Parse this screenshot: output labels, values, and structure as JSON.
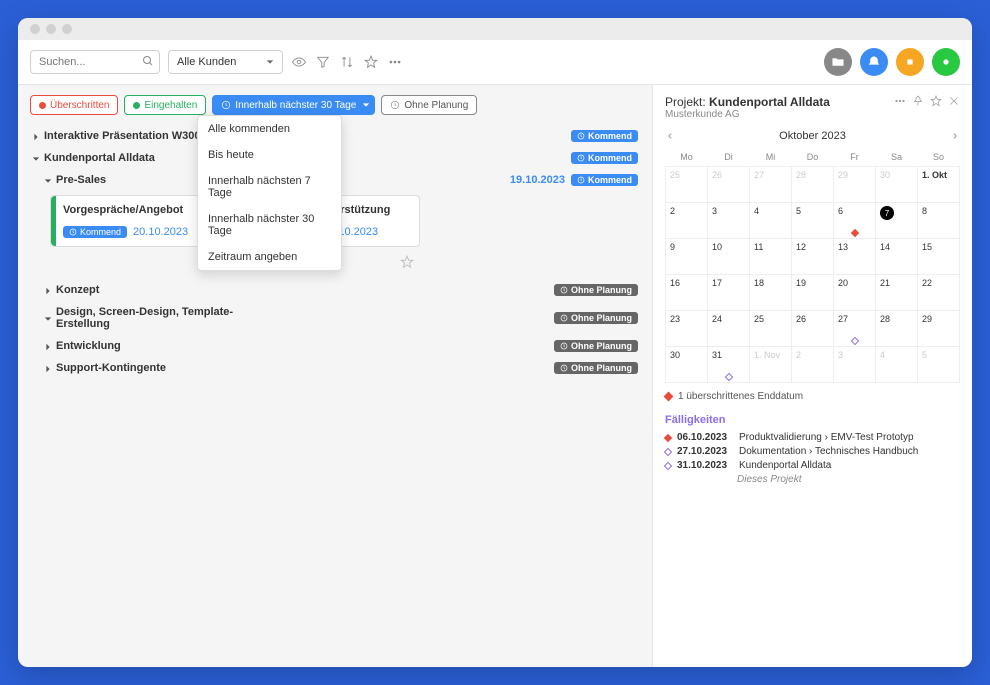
{
  "toolbar": {
    "search_placeholder": "Suchen...",
    "customer_dropdown": "Alle Kunden"
  },
  "filters": {
    "overschritten": "Überschritten",
    "eingehalten": "Eingehalten",
    "innerhalb": "Innerhalb nächster 30 Tage",
    "ohne": "Ohne Planung"
  },
  "dropdown_items": [
    "Alle kommenden",
    "Bis heute",
    "Innerhalb nächsten 7 Tage",
    "Innerhalb nächster 30 Tage",
    "Zeitraum angeben"
  ],
  "tree": {
    "item1": "Interaktive Präsentation W3000-Serie",
    "item2": "Kundenportal Alldata",
    "presales": "Pre-Sales",
    "presales_date": "19.10.2023",
    "card1_title": "Vorgespräche/Angebot",
    "card1_date": "20.10.2023",
    "card2_title": "Technische Unterstützung",
    "card2_date": "18.10.2023",
    "konzept": "Konzept",
    "design": "Design, Screen-Design, Template-Erstellung",
    "entwicklung": "Entwicklung",
    "support": "Support-Kontingente",
    "badge_kommend": "Kommend",
    "badge_ohne": "Ohne Planung"
  },
  "right": {
    "project_label": "Projekt:",
    "project_name": "Kundenportal Alldata",
    "customer": "Musterkunde AG",
    "cal_title": "Oktober 2023",
    "weekdays": [
      "Mo",
      "Di",
      "Mi",
      "Do",
      "Fr",
      "Sa",
      "So"
    ],
    "legend_text": "1 überschrittenes Enddatum",
    "falligkeiten_title": "Fälligkeiten",
    "fall": [
      {
        "date": "06.10.2023",
        "text": "Produktvalidierung › EMV-Test Prototyp",
        "type": "red"
      },
      {
        "date": "27.10.2023",
        "text": "Dokumentation › Technisches Handbuch",
        "type": "vio"
      },
      {
        "date": "31.10.2023",
        "text": "Kundenportal Alldata",
        "type": "vio"
      }
    ],
    "fall_note": "Dieses Projekt"
  }
}
